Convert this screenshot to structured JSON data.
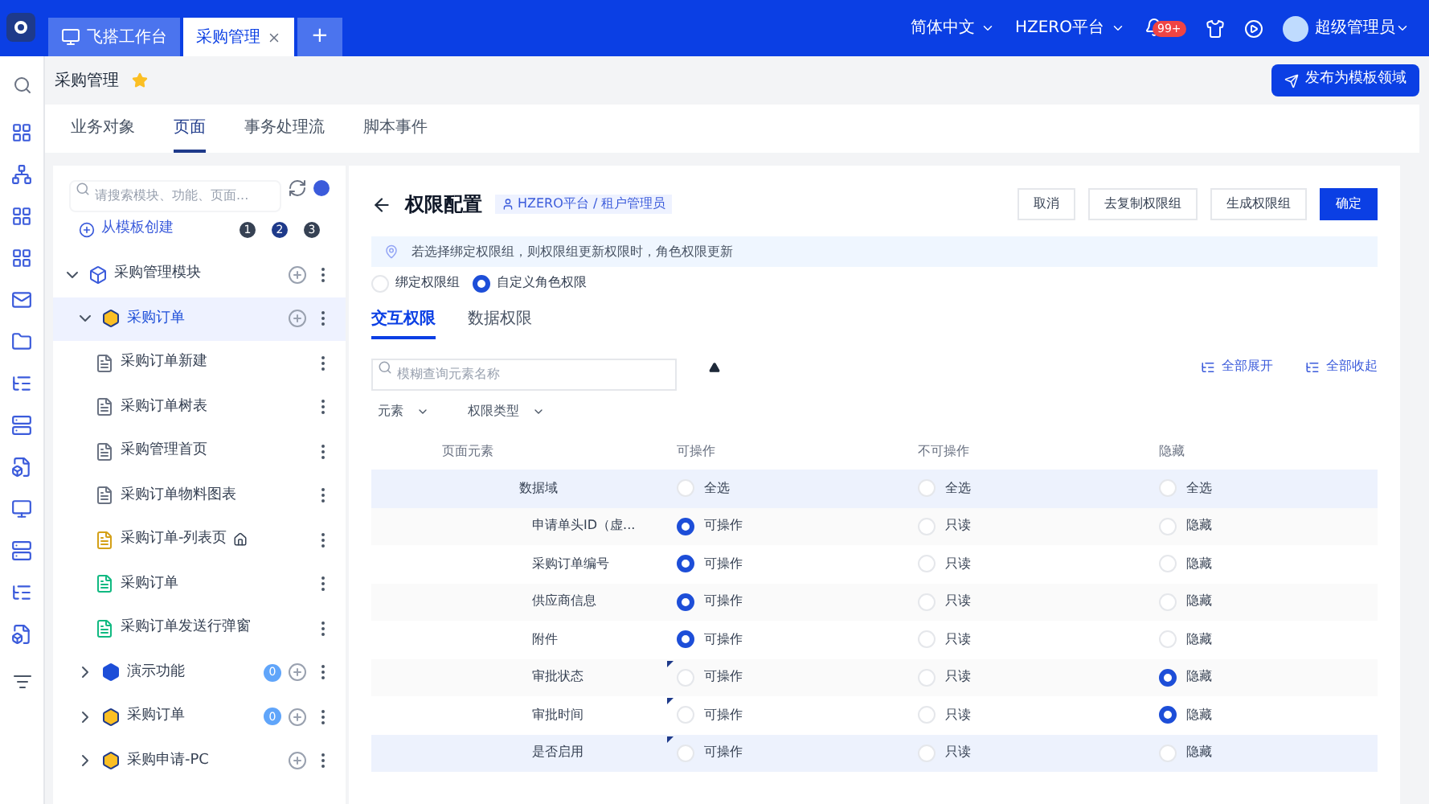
{
  "top_tabs": [
    {
      "label": "飞搭工作台",
      "selected": false,
      "closable": false
    },
    {
      "label": "采购管理",
      "selected": true,
      "closable": true
    }
  ],
  "add_tab": "+",
  "header": {
    "language": "简体中文",
    "platform": "HZERO平台",
    "badge": "99+",
    "user": "超级管理员"
  },
  "breadcrumb": {
    "title": "采购管理",
    "favorite": true
  },
  "publish_button": "发布为模板领域",
  "module_tabs": [
    {
      "label": "业务对象",
      "selected": false
    },
    {
      "label": "页面",
      "selected": true
    },
    {
      "label": "事务处理流",
      "selected": false
    },
    {
      "label": "脚本事件",
      "selected": false
    }
  ],
  "tree_search": {
    "placeholder": "请搜索模块、功能、页面..."
  },
  "create_from_template": "从模板创建",
  "levels": [
    {
      "label": "1",
      "selected": false
    },
    {
      "label": "2",
      "selected": true
    },
    {
      "label": "3",
      "selected": false
    }
  ],
  "tree": [
    {
      "label": "采购管理模块",
      "kind": "module",
      "expanded": true,
      "selected": false,
      "children": [
        {
          "label": "采购订单",
          "kind": "function",
          "expanded": true,
          "selected": true,
          "children": [
            {
              "label": "采购订单新建",
              "kind": "page",
              "selected": false
            },
            {
              "label": "采购订单树表",
              "kind": "page",
              "selected": false
            },
            {
              "label": "采购管理首页",
              "kind": "page",
              "selected": false
            },
            {
              "label": "采购订单物料图表",
              "kind": "page",
              "selected": false
            },
            {
              "label": "采购订单-列表页",
              "kind": "page-home",
              "selected": false
            },
            {
              "label": "采购订单",
              "kind": "page-green",
              "selected": false
            },
            {
              "label": "采购订单发送行弹窗",
              "kind": "page-green",
              "selected": false
            }
          ]
        },
        {
          "label": "演示功能",
          "kind": "function-blue",
          "expanded": false,
          "selected": false,
          "count": "0"
        },
        {
          "label": "采购订单",
          "kind": "function",
          "expanded": false,
          "selected": false,
          "count": "0"
        },
        {
          "label": "采购申请-PC",
          "kind": "function",
          "expanded": false,
          "selected": false
        }
      ]
    }
  ],
  "config": {
    "title": "权限配置",
    "role": "HZERO平台 / 租户管理员",
    "buttons": [
      {
        "label": "取消",
        "primary": false
      },
      {
        "label": "去复制权限组",
        "primary": false
      },
      {
        "label": "生成权限组",
        "primary": false
      },
      {
        "label": "确定",
        "primary": true
      }
    ],
    "notice": "若选择绑定权限组，则权限组更新权限时，角色权限更新",
    "modes": [
      {
        "label": "绑定权限组",
        "selected": false
      },
      {
        "label": "自定义角色权限",
        "selected": true
      }
    ],
    "tabs": [
      {
        "label": "交互权限",
        "selected": true
      },
      {
        "label": "数据权限",
        "selected": false
      }
    ],
    "search": {
      "placeholder": "模糊查询元素名称"
    },
    "expand_all": "全部展开",
    "collapse_all": "全部收起",
    "filters": [
      "元素",
      "权限类型"
    ],
    "columns": [
      "页面元素",
      "可操作",
      "不可操作",
      "隐藏"
    ],
    "rows": [
      {
        "name": "数据域",
        "kind": "group",
        "highlight": true,
        "flag": false,
        "options": [
          {
            "label": "全选",
            "selected": false
          },
          {
            "label": "全选",
            "selected": false
          },
          {
            "label": "全选",
            "selected": false
          }
        ]
      },
      {
        "name": "申请单头ID（虚...",
        "kind": "field",
        "highlight": false,
        "flag": false,
        "options": [
          {
            "label": "可操作",
            "selected": true
          },
          {
            "label": "只读",
            "selected": false
          },
          {
            "label": "隐藏",
            "selected": false
          }
        ]
      },
      {
        "name": "采购订单编号",
        "kind": "field",
        "highlight": false,
        "flag": false,
        "options": [
          {
            "label": "可操作",
            "selected": true
          },
          {
            "label": "只读",
            "selected": false
          },
          {
            "label": "隐藏",
            "selected": false
          }
        ]
      },
      {
        "name": "供应商信息",
        "kind": "field",
        "highlight": false,
        "flag": false,
        "options": [
          {
            "label": "可操作",
            "selected": true
          },
          {
            "label": "只读",
            "selected": false
          },
          {
            "label": "隐藏",
            "selected": false
          }
        ]
      },
      {
        "name": "附件",
        "kind": "field",
        "highlight": false,
        "flag": false,
        "options": [
          {
            "label": "可操作",
            "selected": true
          },
          {
            "label": "只读",
            "selected": false
          },
          {
            "label": "隐藏",
            "selected": false
          }
        ]
      },
      {
        "name": "审批状态",
        "kind": "field",
        "highlight": false,
        "flag": true,
        "options": [
          {
            "label": "可操作",
            "selected": false
          },
          {
            "label": "只读",
            "selected": false
          },
          {
            "label": "隐藏",
            "selected": true
          }
        ]
      },
      {
        "name": "审批时间",
        "kind": "field",
        "highlight": false,
        "flag": true,
        "options": [
          {
            "label": "可操作",
            "selected": false
          },
          {
            "label": "只读",
            "selected": false
          },
          {
            "label": "隐藏",
            "selected": true
          }
        ]
      },
      {
        "name": "是否启用",
        "kind": "field",
        "highlight": true,
        "flag": true,
        "options": [
          {
            "label": "可操作",
            "selected": false
          },
          {
            "label": "只读",
            "selected": false
          },
          {
            "label": "隐藏",
            "selected": false
          }
        ]
      }
    ]
  }
}
